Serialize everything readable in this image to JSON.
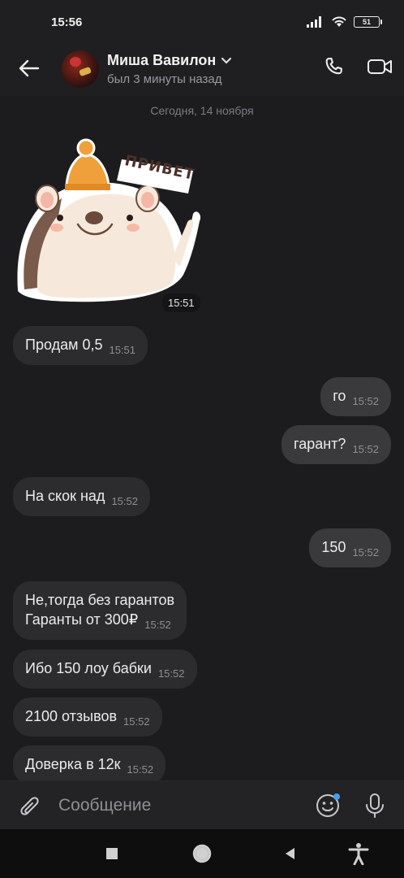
{
  "status_bar": {
    "time": "15:56",
    "battery": "51"
  },
  "header": {
    "contact_name": "Миша Вавилон",
    "contact_status": "был 3 минуты назад"
  },
  "chat": {
    "date_label": "Сегодня, 14 ноября",
    "sticker": {
      "text": "ПРИВЕТ",
      "time": "15:51"
    },
    "messages": [
      {
        "direction": "in",
        "text": "Продам 0,5",
        "time": "15:51"
      },
      {
        "direction": "out",
        "text": "го",
        "time": "15:52"
      },
      {
        "direction": "out",
        "text": "гарант?",
        "time": "15:52"
      },
      {
        "direction": "in",
        "text": "На скок над",
        "time": "15:52"
      },
      {
        "direction": "out",
        "text": "150",
        "time": "15:52"
      },
      {
        "direction": "in",
        "text_line1": "Не,тогда без гарантов",
        "text_line2": "Гаранты от 300₽",
        "time": "15:52"
      },
      {
        "direction": "in",
        "text": "Ибо 150 лоу бабки",
        "time": "15:52"
      },
      {
        "direction": "in",
        "text": "2100 отзывов",
        "time": "15:52"
      },
      {
        "direction": "in",
        "text": "Доверка в 12к",
        "time": "15:52"
      }
    ]
  },
  "input_bar": {
    "placeholder": "Сообщение"
  },
  "colors": {
    "background": "#1c1c1e",
    "bubble_in": "#2c2c2e",
    "bubble_out": "#3a3a3c",
    "accent_dot": "#4a9de8",
    "sticker_hat": "#f0a03a"
  }
}
